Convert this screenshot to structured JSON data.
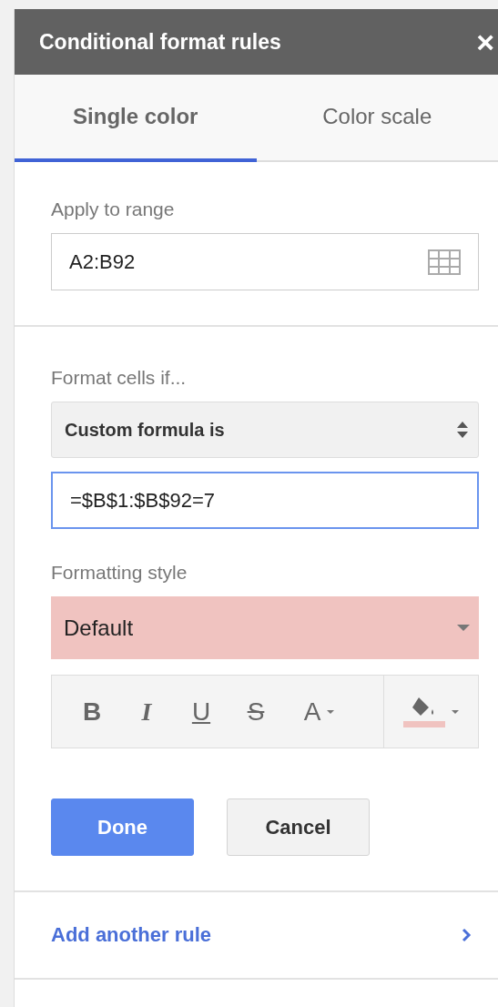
{
  "panel": {
    "title": "Conditional format rules",
    "close": "×"
  },
  "tabs": [
    {
      "label": "Single color",
      "selected": true
    },
    {
      "label": "Color scale",
      "selected": false
    }
  ],
  "range": {
    "label": "Apply to range",
    "value": "A2:B92"
  },
  "condition": {
    "label": "Format cells if...",
    "value": "Custom formula is",
    "formula": "=$B$1:$B$92=7",
    "focused": true
  },
  "formatting_style": {
    "label": "Formatting style",
    "value": "Default",
    "color": "#f0c3c0"
  },
  "toolbar": [
    {
      "kind": "bold",
      "label": "B"
    },
    {
      "kind": "italic",
      "label": "I"
    },
    {
      "kind": "underline",
      "label": "U"
    },
    {
      "kind": "strike",
      "label": "S"
    },
    {
      "kind": "text-color",
      "label": "A"
    },
    {
      "kind": "fill-color",
      "color": "#f0c3c0"
    }
  ],
  "buttons": [
    {
      "label": "Done",
      "primary": true
    },
    {
      "label": "Cancel",
      "primary": false
    }
  ],
  "add_rule": "Add another rule"
}
